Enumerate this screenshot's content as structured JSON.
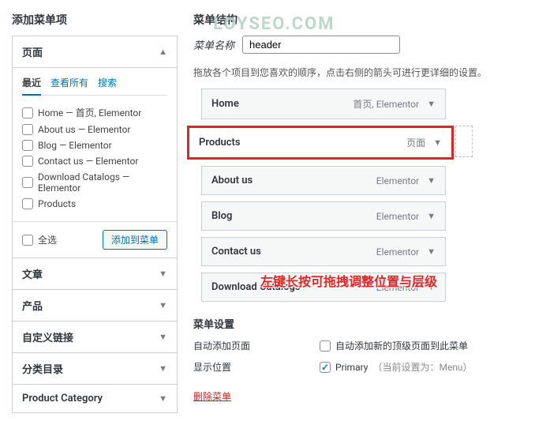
{
  "watermark": "LOYSEO.COM",
  "left": {
    "title": "添加菜单项",
    "pages": {
      "label": "页面",
      "tabs": [
        "最近",
        "查看所有",
        "搜索"
      ],
      "active_tab": 0,
      "items": [
        "Home — 首页, Elementor",
        "About us — Elementor",
        "Blog — Elementor",
        "Contact us — Elementor",
        "Download Catalogs — Elementor",
        "Products"
      ],
      "select_all": "全选",
      "add_btn": "添加到菜单"
    },
    "accordions": [
      "文章",
      "产品",
      "自定义链接",
      "分类目录",
      "Product Category"
    ]
  },
  "right": {
    "title": "菜单结构",
    "name_label": "菜单名称",
    "name_value": "header",
    "hint": "拖放各个项目到您喜欢的顺序，点击右侧的箭头可进行更详细的设置。",
    "items": [
      {
        "title": "Home",
        "type": "首页, Elementor"
      },
      {
        "title": "Products",
        "type": "页面",
        "highlight": true
      },
      {
        "title": "About us",
        "type": "Elementor"
      },
      {
        "title": "Blog",
        "type": "Elementor"
      },
      {
        "title": "Contact us",
        "type": "Elementor"
      },
      {
        "title": "Download Catalogs",
        "type": "Elementor"
      }
    ],
    "annotation": "左键长按可拖拽调整位置与层级",
    "settings": {
      "heading": "菜单设置",
      "auto_add_label": "自动添加页面",
      "auto_add_text": "自动添加新的顶级页面到此菜单",
      "display_label": "显示位置",
      "primary": "Primary",
      "primary_note": "（当前设置为：Menu）"
    },
    "delete": "删除菜单"
  }
}
